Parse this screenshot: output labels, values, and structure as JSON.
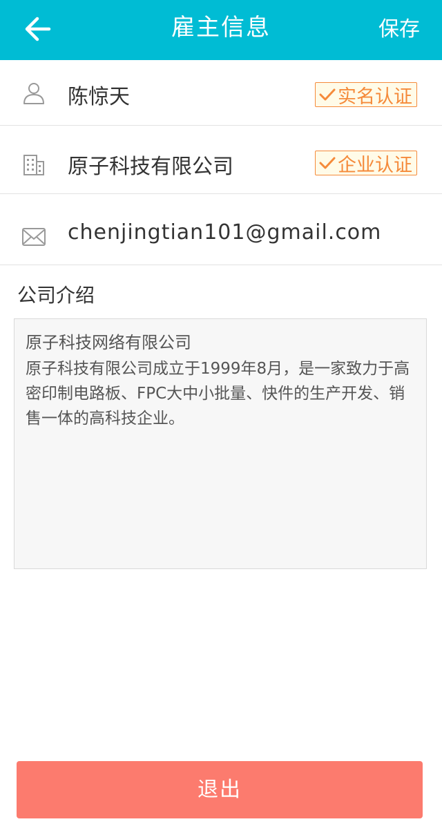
{
  "header": {
    "title": "雇主信息",
    "save_label": "保存",
    "back_icon": "arrow-left-icon"
  },
  "profile": {
    "name": "陈惊天",
    "name_badge": "实名认证",
    "company": "原子科技有限公司",
    "company_badge": "企业认证",
    "email": "chenjingtian101@gmail.com"
  },
  "intro": {
    "label": "公司介绍",
    "title": "原子科技网络有限公司",
    "body": "原子科技有限公司成立于1999年8月，是一家致力于高密印制电路板、FPC大中小批量、快件的生产开发、销售一体的高科技企业。"
  },
  "footer": {
    "logout_label": "退出"
  },
  "colors": {
    "header_bg": "#00bcd4",
    "badge": "#f58a3a",
    "logout_bg": "#fc7b6e"
  }
}
